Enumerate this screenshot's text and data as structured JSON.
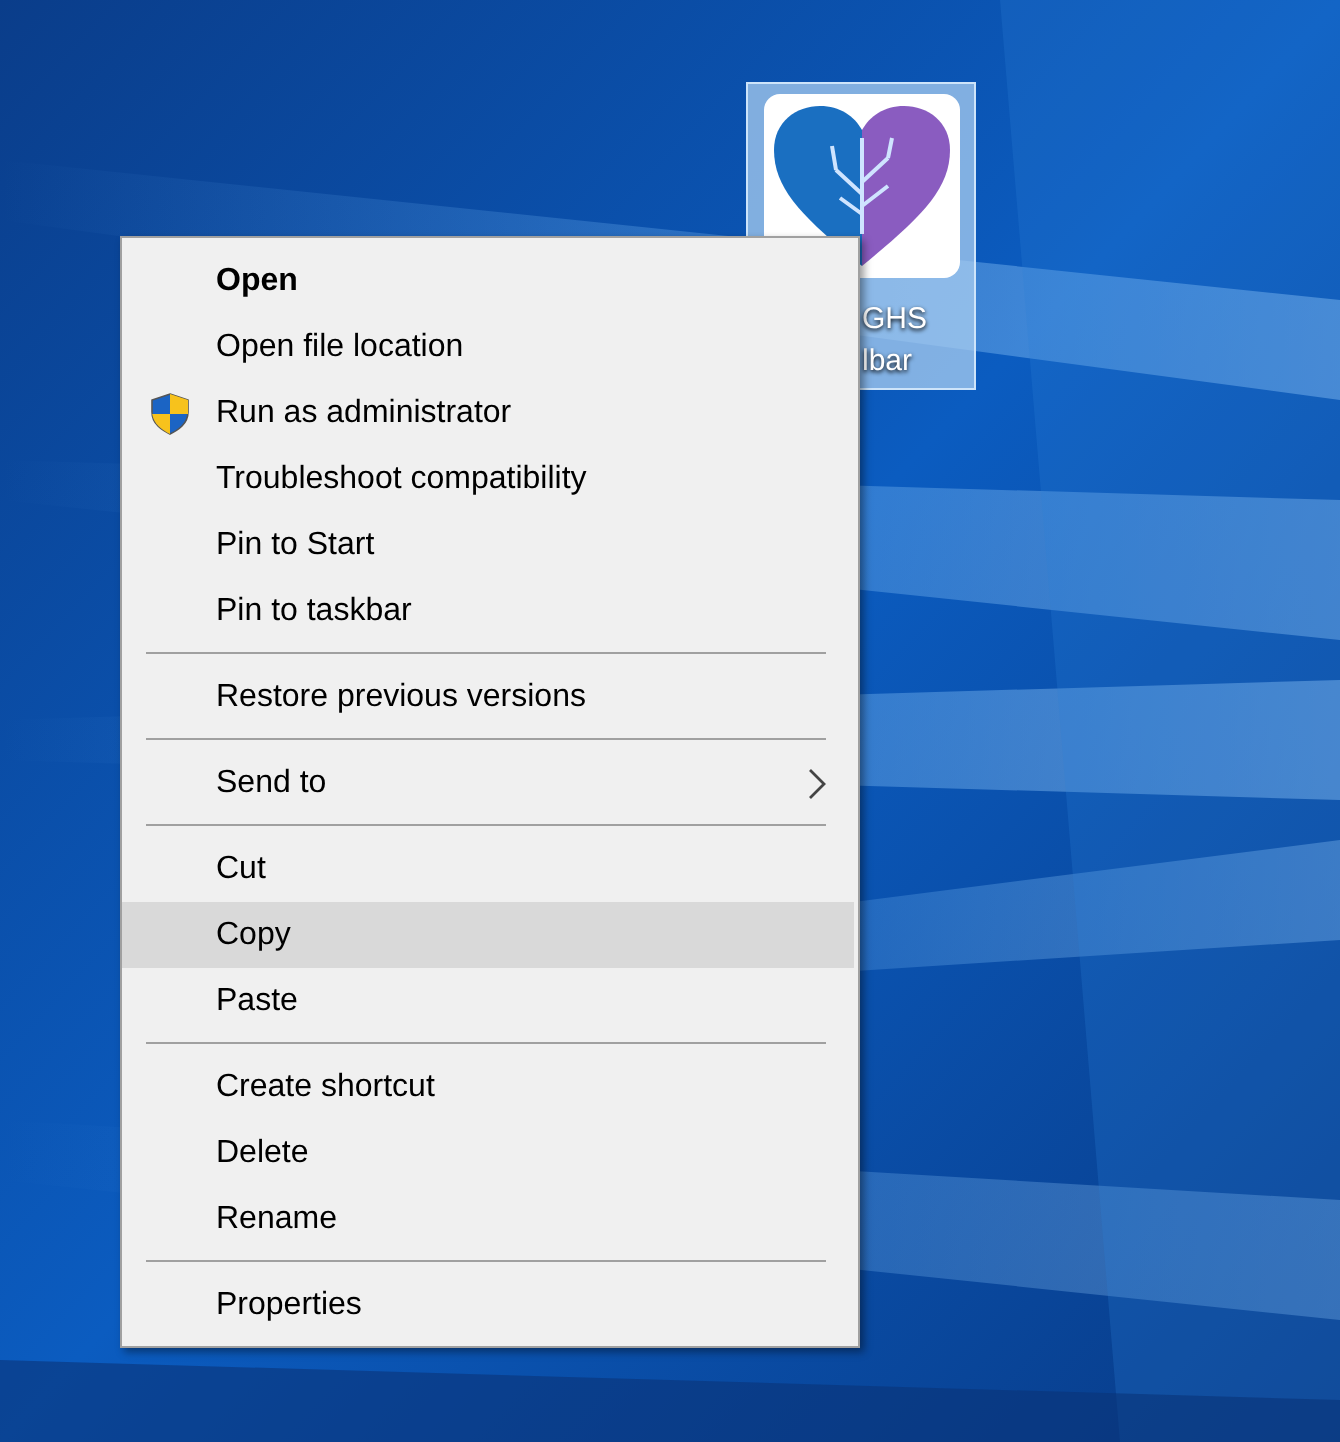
{
  "desktop_icon": {
    "label_lines": [
      "GHS",
      "lbar"
    ],
    "selected": true
  },
  "context_menu": {
    "groups": [
      {
        "items": [
          {
            "label": "Open",
            "kind": "default",
            "selected": false
          },
          {
            "label": "Open file location",
            "kind": "plain",
            "selected": false
          },
          {
            "label": "Run as administrator",
            "kind": "shield",
            "selected": false
          },
          {
            "label": "Troubleshoot compatibility",
            "kind": "plain",
            "selected": false
          },
          {
            "label": "Pin to Start",
            "kind": "plain",
            "selected": false
          },
          {
            "label": "Pin to taskbar",
            "kind": "plain",
            "selected": false
          }
        ]
      },
      {
        "items": [
          {
            "label": "Restore previous versions",
            "kind": "plain",
            "selected": false
          }
        ]
      },
      {
        "items": [
          {
            "label": "Send to",
            "kind": "submenu",
            "selected": false
          }
        ]
      },
      {
        "items": [
          {
            "label": "Cut",
            "kind": "plain",
            "selected": false
          },
          {
            "label": "Copy",
            "kind": "plain",
            "selected": true
          },
          {
            "label": "Paste",
            "kind": "plain",
            "selected": false
          }
        ]
      },
      {
        "items": [
          {
            "label": "Create shortcut",
            "kind": "plain",
            "selected": false
          },
          {
            "label": "Delete",
            "kind": "plain",
            "selected": false
          },
          {
            "label": "Rename",
            "kind": "plain",
            "selected": false
          }
        ]
      },
      {
        "items": [
          {
            "label": "Properties",
            "kind": "plain",
            "selected": false
          }
        ]
      }
    ]
  }
}
